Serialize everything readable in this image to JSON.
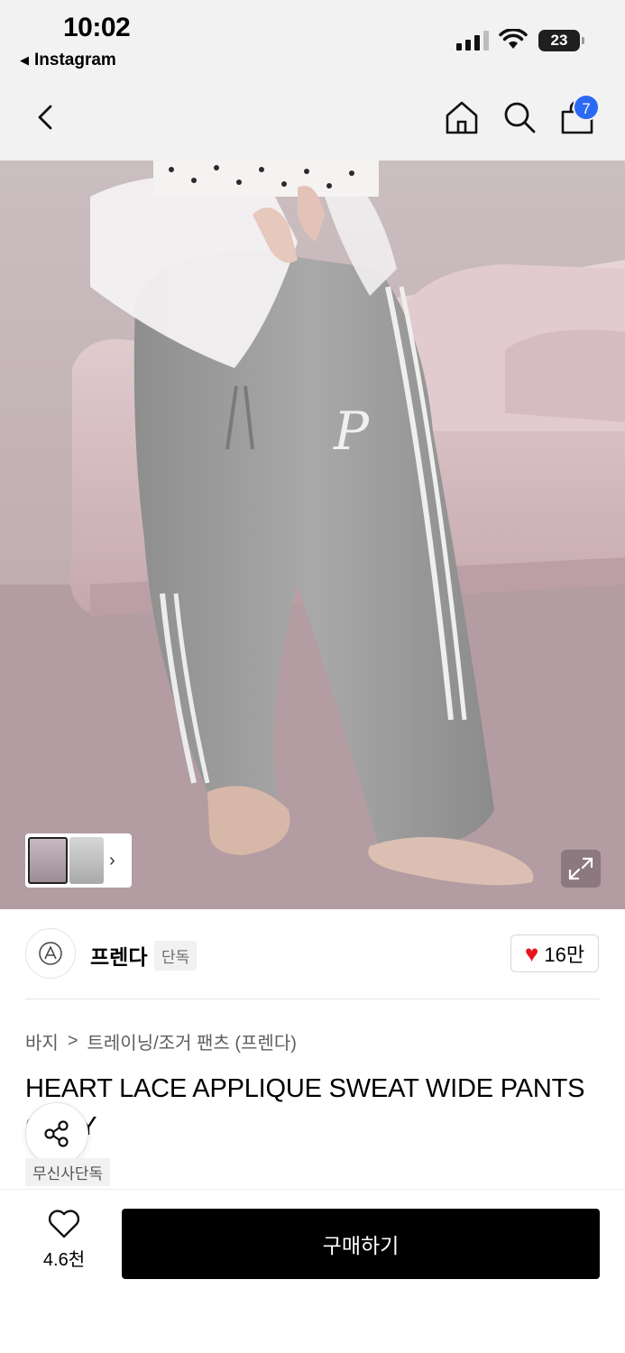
{
  "status_bar": {
    "time": "10:02",
    "back_app": "Instagram",
    "battery": "23"
  },
  "nav": {
    "cart_count": "7"
  },
  "gallery": {
    "thumb_arrow": "›"
  },
  "brand": {
    "name": "프렌다",
    "tag": "단독",
    "like_count": "16만"
  },
  "breadcrumb": {
    "category": "바지",
    "separator": ">",
    "subcategory": "트레이닝/조거 팬츠 (프렌다)"
  },
  "product": {
    "title": "HEART LACE APPLIQUE SWEAT WIDE PANTS GRAY",
    "exclusive_tag": "무신사단독"
  },
  "bottom_bar": {
    "wish_count": "4.6천",
    "buy_label": "구매하기"
  },
  "colors": {
    "accent_badge": "#2b6af3",
    "heart": "#e8131f",
    "buy_button": "#000000"
  }
}
